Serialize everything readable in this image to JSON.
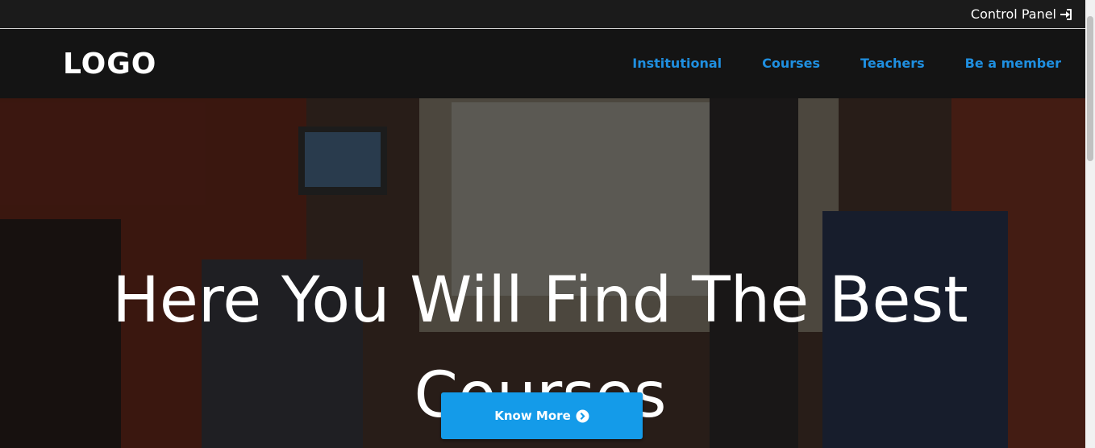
{
  "topbar": {
    "control_panel_label": "Control Panel",
    "icon": "sign-in-icon"
  },
  "header": {
    "logo": "LOGO"
  },
  "nav": {
    "items": [
      "Institutional",
      "Courses",
      "Teachers",
      "Be a member"
    ],
    "color": "#1f8fe0"
  },
  "hero": {
    "title": "Here You Will Find The Best Courses",
    "button_label": "Know More",
    "button_icon": "chevron-circle-right-icon",
    "button_color": "#149be9"
  }
}
